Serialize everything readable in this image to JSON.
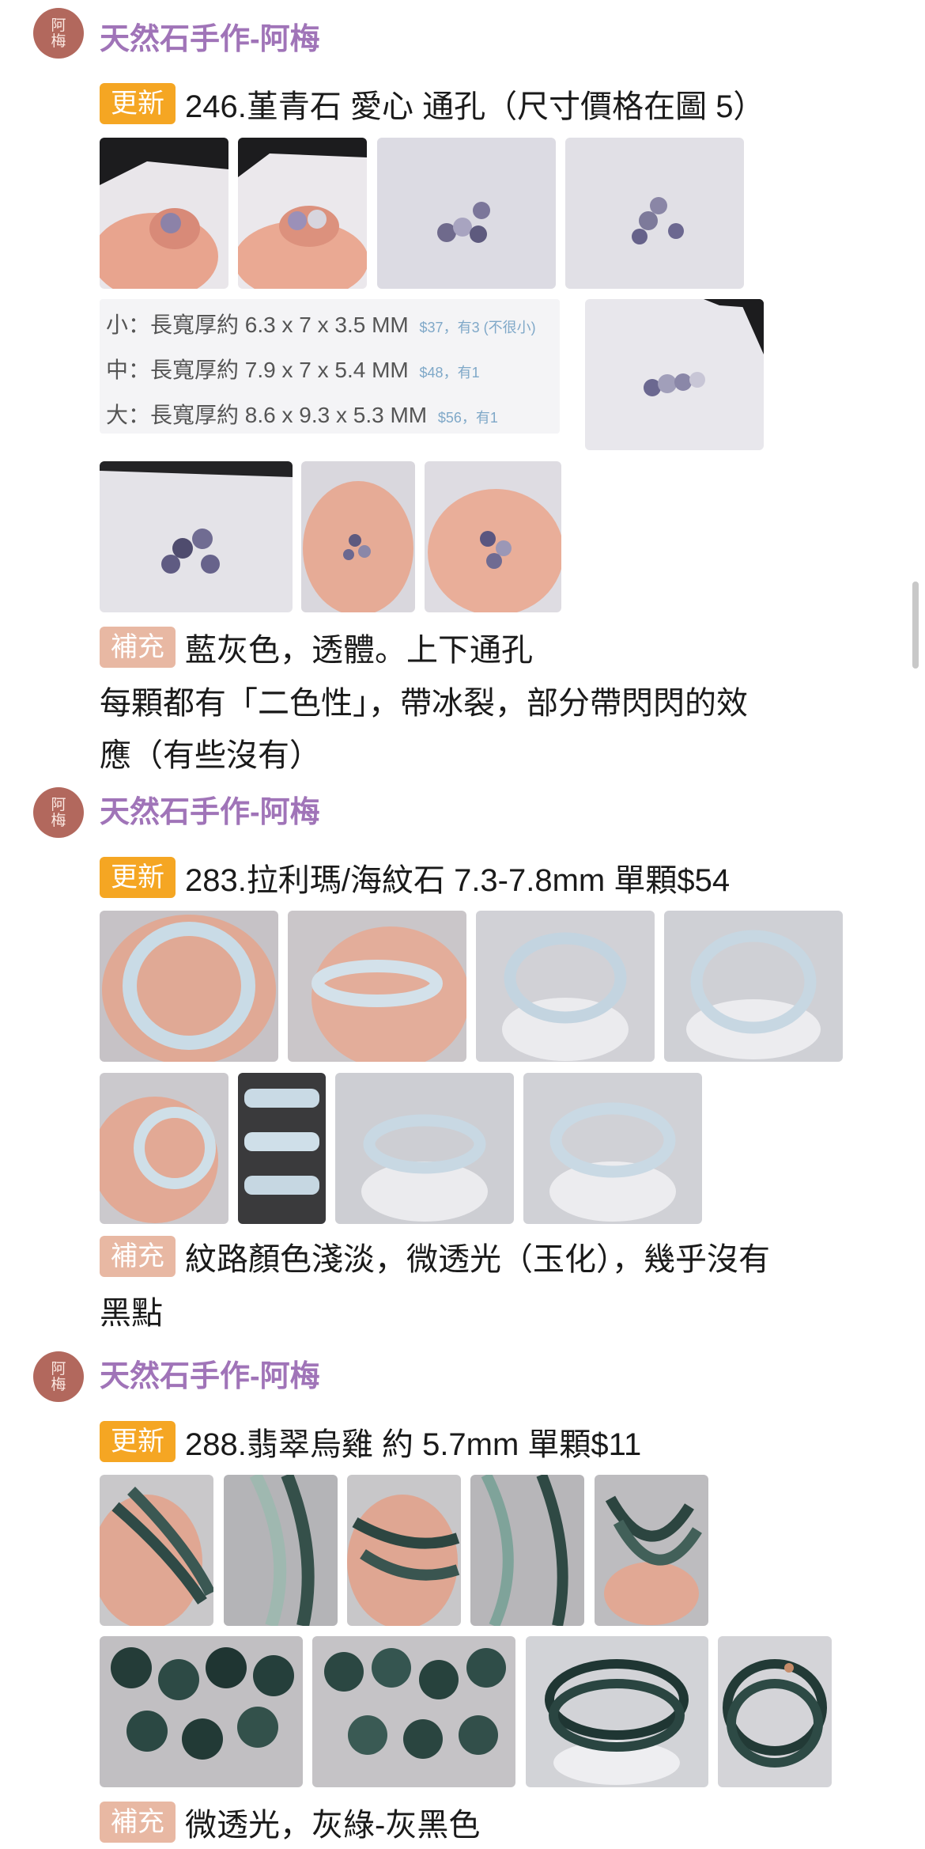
{
  "author": "天然石手作-阿梅",
  "avatar_text": [
    "阿",
    "梅"
  ],
  "badges": {
    "update": "更新",
    "supplement": "補充"
  },
  "posts": [
    {
      "title": "246.堇青石 愛心 通孔（尺寸價格在圖 5）",
      "size_table": [
        {
          "label": "小：長寬厚約 6.3 x 7 x 3.5 MM",
          "price": "$37，有3 (不很小)"
        },
        {
          "label": "中：長寬厚約 7.9 x 7 x 5.4 MM",
          "price": "$48，有1"
        },
        {
          "label": "大：長寬厚約 8.6 x 9.3 x 5.3 MM",
          "price": "$56，有1"
        }
      ],
      "supplement": "藍灰色，透體。上下通孔",
      "body_lines": [
        "每顆都有「二色性」，帶冰裂，部分帶閃閃的效",
        "應（有些沒有）"
      ]
    },
    {
      "title": "283.拉利瑪/海紋石 7.3-7.8mm 單顆$54",
      "supplement": "紋路顏色淺淡，微透光（玉化），幾乎沒有",
      "body_lines": [
        "黑點"
      ]
    },
    {
      "title": "288.翡翠烏雞 約 5.7mm 單顆$11",
      "supplement": "微透光，灰綠-灰黑色",
      "body_lines": []
    }
  ],
  "colors": {
    "author": "#a074b8",
    "update_badge": "#f5a623",
    "supplement_badge": "#e8b8a3",
    "avatar": "#b2685d"
  },
  "icons": [
    "avatar-image",
    "product-photo"
  ]
}
